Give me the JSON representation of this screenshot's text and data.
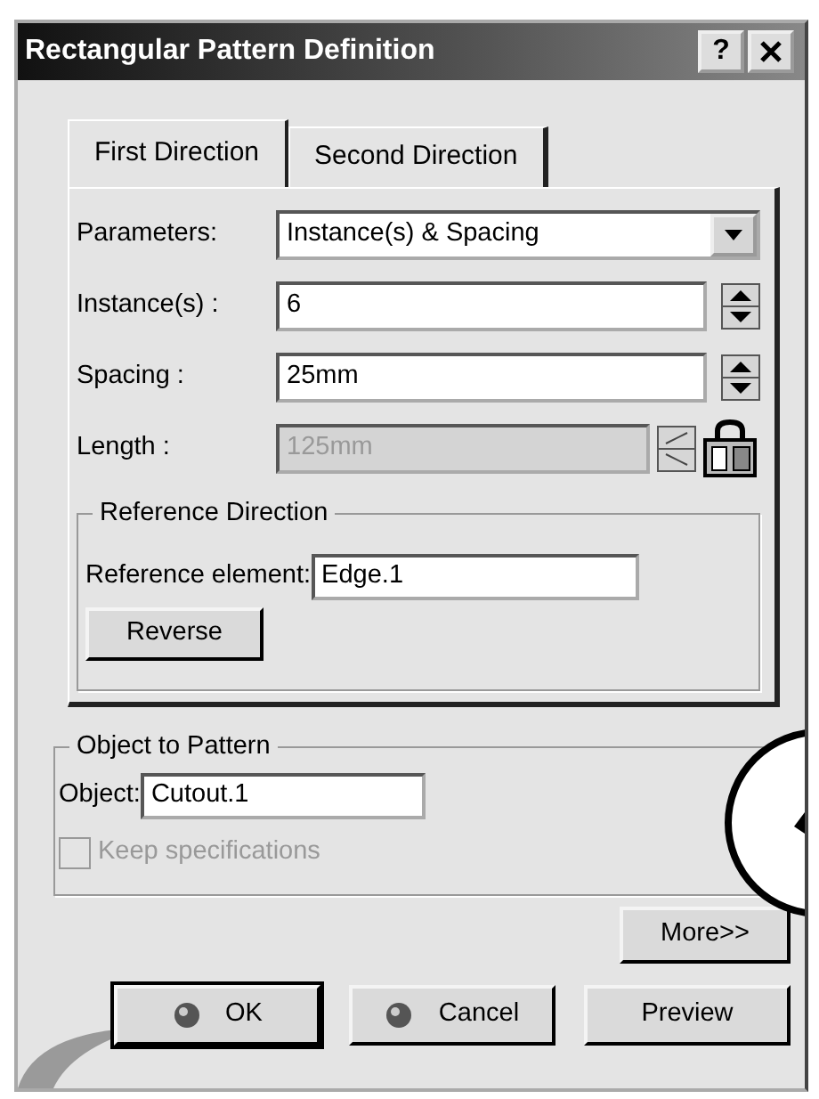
{
  "window": {
    "title": "Rectangular Pattern Definition",
    "help_button": "?"
  },
  "tabs": [
    {
      "label": "First Direction",
      "selected": true
    },
    {
      "label": "Second Direction",
      "selected": false
    }
  ],
  "fields": [
    {
      "kind": "select",
      "label": "Parameters:",
      "value": "Instance(s) & Spacing",
      "disabled": false
    },
    {
      "kind": "spin",
      "label": "Instance(s) :",
      "value": "6",
      "disabled": false
    },
    {
      "kind": "spin",
      "label": "Spacing :",
      "value": "25mm",
      "disabled": false
    },
    {
      "kind": "spin_lock",
      "label": "Length :",
      "value": "125mm",
      "disabled": true
    }
  ],
  "reference_direction": {
    "title": "Reference Direction",
    "element_label": "Reference element:",
    "element_value": "Edge.1",
    "reverse_button": "Reverse"
  },
  "object_to_pattern": {
    "title": "Object to Pattern",
    "object_label": "Object:",
    "object_value": "Cutout.1",
    "keep_specifications": {
      "label": "Keep specifications",
      "checked": false,
      "disabled": true
    }
  },
  "more_button": "More>>",
  "dialog_buttons": [
    {
      "label": "OK",
      "kind": "icon",
      "default": true
    },
    {
      "label": "Cancel",
      "kind": "icon",
      "default": false
    },
    {
      "label": "Preview",
      "kind": "plain",
      "default": false
    }
  ]
}
